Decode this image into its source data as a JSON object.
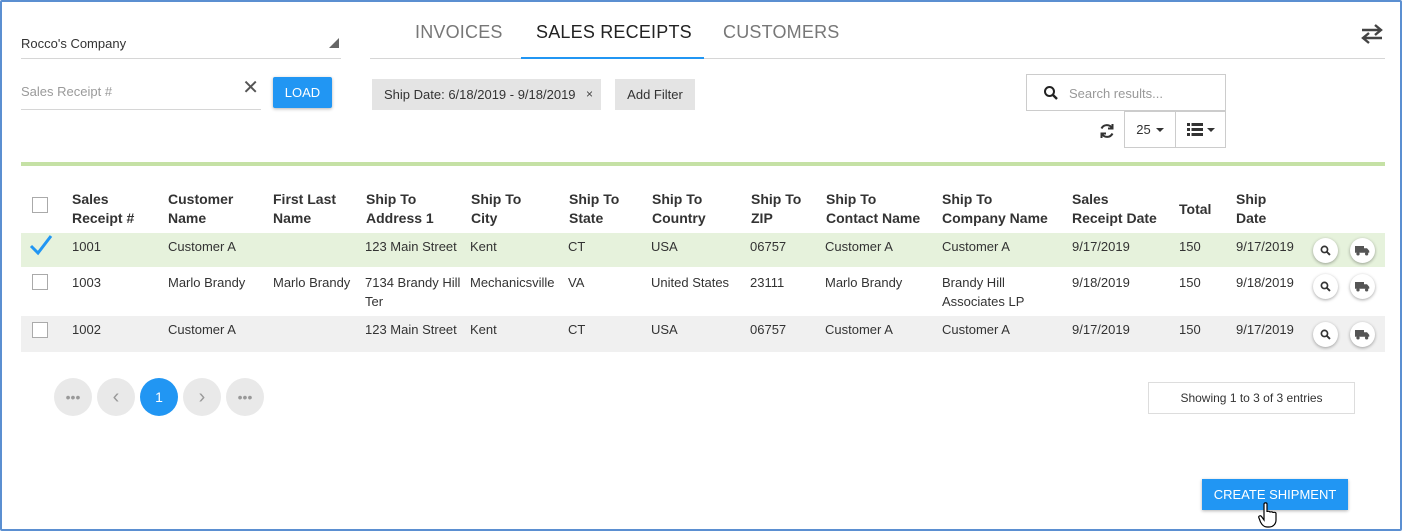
{
  "company": {
    "selected": "Rocco's Company"
  },
  "receipt_search": {
    "placeholder": "Sales Receipt #",
    "value": "",
    "load_label": "LOAD"
  },
  "tabs": [
    {
      "label": "INVOICES",
      "active": false
    },
    {
      "label": "SALES RECEIPTS",
      "active": true
    },
    {
      "label": "CUSTOMERS",
      "active": false
    }
  ],
  "filters": {
    "chip_label": "Ship Date: 6/18/2019 - 9/18/2019",
    "chip_remove": "×",
    "add_filter_label": "Add Filter"
  },
  "search": {
    "placeholder": "Search results..."
  },
  "page_size": "25",
  "table": {
    "headers": {
      "receipt": [
        "Sales",
        "Receipt #"
      ],
      "customer": [
        "Customer",
        "Name"
      ],
      "first_last": [
        "First Last",
        "Name"
      ],
      "address": [
        "Ship To",
        "Address 1"
      ],
      "city": [
        "Ship To",
        "City"
      ],
      "state": [
        "Ship To",
        "State"
      ],
      "country": [
        "Ship To",
        "Country"
      ],
      "zip": [
        "Ship To",
        "ZIP"
      ],
      "contact": [
        "Ship To",
        "Contact Name"
      ],
      "company": [
        "Ship To",
        "Company Name"
      ],
      "receipt_date": [
        "Sales",
        "Receipt Date"
      ],
      "total": [
        "Total"
      ],
      "ship_date": [
        "Ship",
        "Date"
      ]
    },
    "rows": [
      {
        "selected": true,
        "receipt": "1001",
        "customer": "Customer A",
        "first_last": "",
        "address": [
          "123 Main Street"
        ],
        "city": "Kent",
        "state": "CT",
        "country": "USA",
        "zip": "06757",
        "contact": "Customer A",
        "company": [
          "Customer A"
        ],
        "receipt_date": "9/17/2019",
        "total": "150",
        "ship_date": "9/17/2019"
      },
      {
        "selected": false,
        "receipt": "1003",
        "customer": "Marlo Brandy",
        "first_last": "Marlo Brandy",
        "address": [
          "7134 Brandy Hill",
          "Ter"
        ],
        "city": "Mechanicsville",
        "state": "VA",
        "country": "United States",
        "zip": "23111",
        "contact": "Marlo Brandy",
        "company": [
          "Brandy Hill",
          "Associates LP"
        ],
        "receipt_date": "9/18/2019",
        "total": "150",
        "ship_date": "9/18/2019"
      },
      {
        "selected": false,
        "receipt": "1002",
        "customer": "Customer A",
        "first_last": "",
        "address": [
          "123 Main Street"
        ],
        "city": "Kent",
        "state": "CT",
        "country": "USA",
        "zip": "06757",
        "contact": "Customer A",
        "company": [
          "Customer A"
        ],
        "receipt_date": "9/17/2019",
        "total": "150",
        "ship_date": "9/17/2019"
      }
    ]
  },
  "pagination": {
    "first": "•••",
    "prev": "‹",
    "current": "1",
    "next": "›",
    "last": "•••"
  },
  "showing": "Showing 1 to 3 of 3 entries",
  "create_shipment_label": "CREATE SHIPMENT",
  "colors": {
    "accent": "#2196f3",
    "selected_row": "#e6f2dc",
    "rule": "#c5e1a5"
  }
}
